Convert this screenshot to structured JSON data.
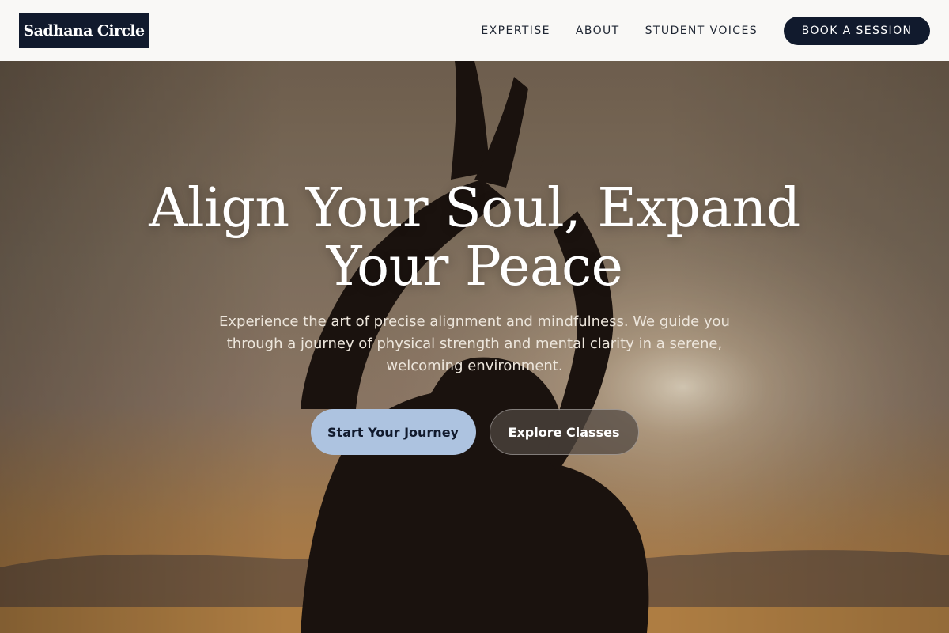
{
  "header": {
    "logo": "Sadhana Circle",
    "nav": [
      {
        "label": "EXPERTISE"
      },
      {
        "label": "ABOUT"
      },
      {
        "label": "STUDENT VOICES"
      }
    ],
    "cta_label": "BOOK A SESSION"
  },
  "hero": {
    "title": "Align Your Soul, Expand Your Peace",
    "subtitle": "Experience the art of precise alignment and mindfulness. We guide you through a journey of physical strength and mental clarity in a serene, welcoming environment.",
    "primary_button": "Start Your Journey",
    "secondary_button": "Explore Classes"
  },
  "colors": {
    "brand_navy": "#111a2d",
    "primary_button_bg": "#adc3e0",
    "header_bg": "#f9f8f6",
    "sunset_warm": "#c98a45"
  }
}
